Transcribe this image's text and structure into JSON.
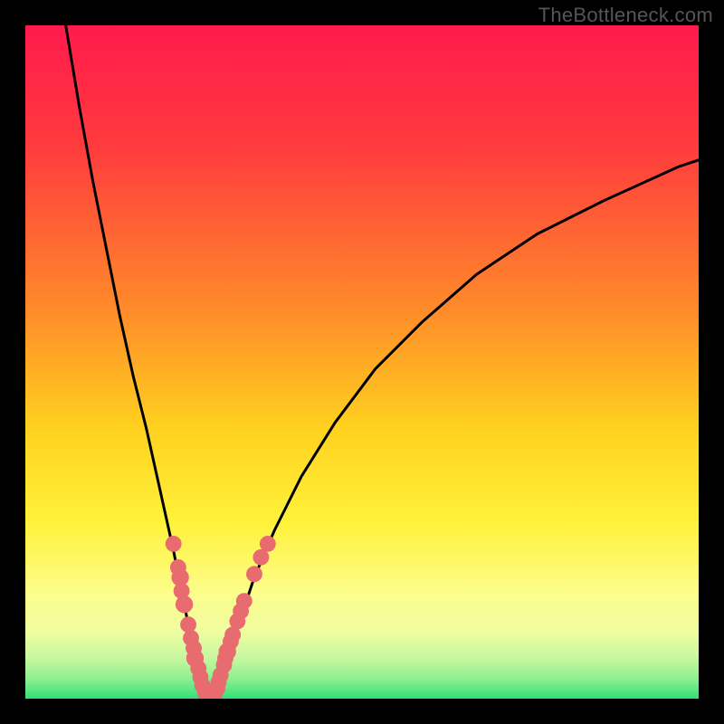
{
  "watermark": "TheBottleneck.com",
  "colors": {
    "frame": "#000000",
    "gradient_stops": [
      {
        "pos": 0,
        "color": "#ff1a4d"
      },
      {
        "pos": 0.18,
        "color": "#ff3b3d"
      },
      {
        "pos": 0.42,
        "color": "#ff8a2a"
      },
      {
        "pos": 0.6,
        "color": "#ffd21f"
      },
      {
        "pos": 0.74,
        "color": "#fff23a"
      },
      {
        "pos": 0.84,
        "color": "#fdfd8a"
      },
      {
        "pos": 0.9,
        "color": "#f0fda0"
      },
      {
        "pos": 0.94,
        "color": "#c7f7a0"
      },
      {
        "pos": 0.97,
        "color": "#8ef08f"
      },
      {
        "pos": 1.0,
        "color": "#33e07a"
      }
    ],
    "curve": "#000000",
    "markers": "#e86b6f"
  },
  "chart_data": {
    "type": "line",
    "title": "",
    "xlabel": "",
    "ylabel": "",
    "xlim": [
      0,
      100
    ],
    "ylim": [
      0,
      100
    ],
    "note": "Axes unlabeled; values on 0-100 normalized scale. y=0 is bottom (green), y=100 is top (red). Two plotted branches form a V with minimum near x≈27,y≈0.",
    "series": [
      {
        "name": "left-branch",
        "x": [
          6,
          8,
          10,
          12,
          14,
          16,
          18,
          20,
          22,
          23.2,
          24.4,
          25.3,
          26,
          26.7,
          27
        ],
        "y": [
          100,
          88,
          77,
          67,
          57,
          48,
          40,
          31,
          22,
          16,
          10,
          6,
          3,
          1,
          0
        ]
      },
      {
        "name": "right-branch",
        "x": [
          27,
          28,
          29.3,
          30.7,
          32,
          34,
          37,
          41,
          46,
          52,
          59,
          67,
          76,
          86,
          97,
          100
        ],
        "y": [
          0,
          1,
          4,
          8,
          12,
          18,
          25,
          33,
          41,
          49,
          56,
          63,
          69,
          74,
          79,
          80
        ]
      }
    ],
    "markers": [
      {
        "x": 22.0,
        "y": 23.0,
        "r": 1.2
      },
      {
        "x": 22.7,
        "y": 19.5,
        "r": 1.2
      },
      {
        "x": 23.0,
        "y": 18.0,
        "r": 1.3
      },
      {
        "x": 23.2,
        "y": 16.0,
        "r": 1.2
      },
      {
        "x": 23.6,
        "y": 14.0,
        "r": 1.3
      },
      {
        "x": 24.2,
        "y": 11.0,
        "r": 1.2
      },
      {
        "x": 24.6,
        "y": 9.0,
        "r": 1.2
      },
      {
        "x": 25.0,
        "y": 7.5,
        "r": 1.2
      },
      {
        "x": 25.2,
        "y": 6.0,
        "r": 1.3
      },
      {
        "x": 25.7,
        "y": 4.5,
        "r": 1.2
      },
      {
        "x": 26.0,
        "y": 3.2,
        "r": 1.2
      },
      {
        "x": 26.3,
        "y": 2.0,
        "r": 1.2
      },
      {
        "x": 26.7,
        "y": 1.0,
        "r": 1.2
      },
      {
        "x": 27.0,
        "y": 0.3,
        "r": 1.3
      },
      {
        "x": 27.5,
        "y": 0.3,
        "r": 1.3
      },
      {
        "x": 28.0,
        "y": 0.5,
        "r": 1.3
      },
      {
        "x": 28.5,
        "y": 1.5,
        "r": 1.2
      },
      {
        "x": 28.7,
        "y": 2.5,
        "r": 1.2
      },
      {
        "x": 29.0,
        "y": 3.5,
        "r": 1.2
      },
      {
        "x": 29.5,
        "y": 5.0,
        "r": 1.2
      },
      {
        "x": 29.7,
        "y": 6.0,
        "r": 1.2
      },
      {
        "x": 30.0,
        "y": 7.0,
        "r": 1.3
      },
      {
        "x": 30.5,
        "y": 8.5,
        "r": 1.2
      },
      {
        "x": 30.8,
        "y": 9.5,
        "r": 1.2
      },
      {
        "x": 31.5,
        "y": 11.5,
        "r": 1.2
      },
      {
        "x": 32.0,
        "y": 13.0,
        "r": 1.2
      },
      {
        "x": 32.5,
        "y": 14.5,
        "r": 1.2
      },
      {
        "x": 34.0,
        "y": 18.5,
        "r": 1.2
      },
      {
        "x": 35.0,
        "y": 21.0,
        "r": 1.2
      },
      {
        "x": 36.0,
        "y": 23.0,
        "r": 1.2
      }
    ]
  }
}
